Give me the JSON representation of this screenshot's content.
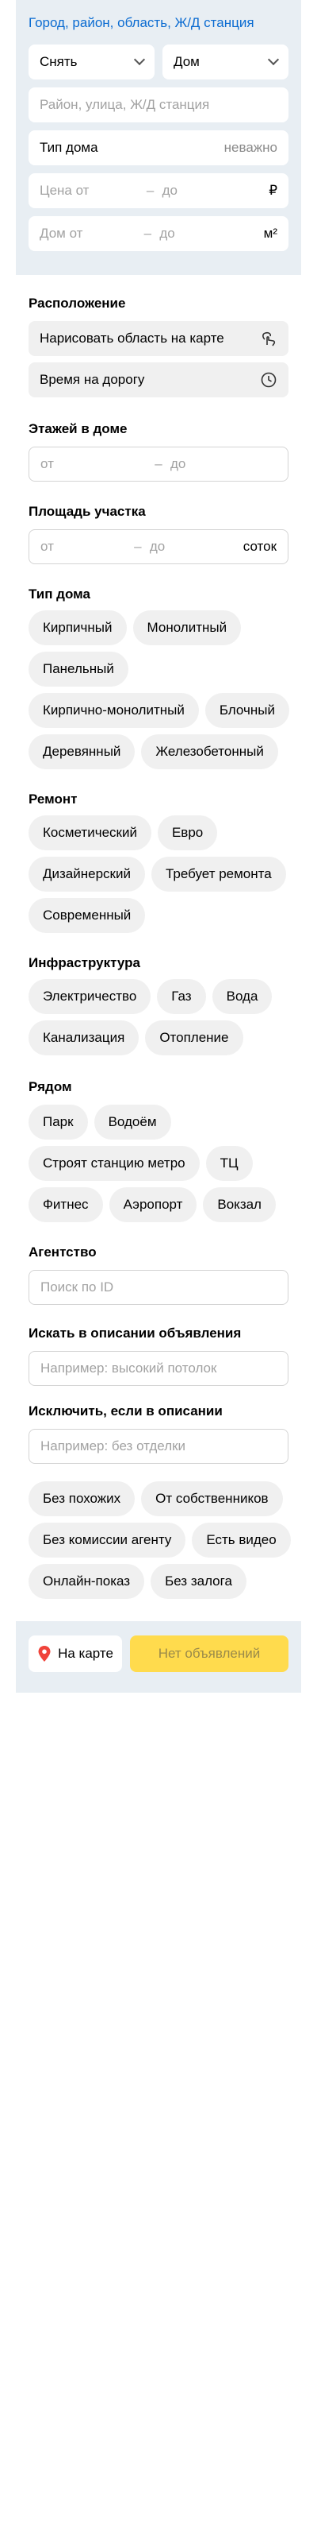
{
  "search_link": "Город, район, область, Ж/Д станция",
  "deal_select": "Снять",
  "type_select": "Дом",
  "address_placeholder": "Район, улица, Ж/Д станция",
  "house_type_label": "Тип дома",
  "house_type_value": "неважно",
  "price": {
    "from": "Цена от",
    "dash": "–",
    "to": "до",
    "unit": "₽"
  },
  "house_area": {
    "from": "Дом от",
    "dash": "–",
    "to": "до",
    "unit": "м²"
  },
  "location": {
    "heading": "Расположение",
    "draw_label": "Нарисовать область на карте",
    "time_label": "Время на дорогу"
  },
  "floors": {
    "heading": "Этажей в доме",
    "from": "от",
    "dash": "–",
    "to": "до"
  },
  "plot": {
    "heading": "Площадь участка",
    "from": "от",
    "dash": "–",
    "to": "до",
    "unit": "соток"
  },
  "building_type": {
    "heading": "Тип дома",
    "chips": [
      "Кирпичный",
      "Монолитный",
      "Панельный",
      "Кирпично-монолитный",
      "Блочный",
      "Деревянный",
      "Железобетонный"
    ]
  },
  "renovation": {
    "heading": "Ремонт",
    "chips": [
      "Косметический",
      "Евро",
      "Дизайнерский",
      "Требует ремонта",
      "Современный"
    ]
  },
  "infrastructure": {
    "heading": "Инфраструктура",
    "chips": [
      "Электричество",
      "Газ",
      "Вода",
      "Канализация",
      "Отопление"
    ]
  },
  "nearby": {
    "heading": "Рядом",
    "chips": [
      "Парк",
      "Водоём",
      "Строят станцию метро",
      "ТЦ",
      "Фитнес",
      "Аэропорт",
      "Вокзал"
    ]
  },
  "agency": {
    "heading": "Агентство",
    "placeholder": "Поиск по ID"
  },
  "search_desc": {
    "heading": "Искать в описании объявления",
    "placeholder": "Например: высокий потолок"
  },
  "exclude_desc": {
    "heading": "Исключить, если в описании",
    "placeholder": "Например: без отделки"
  },
  "extra": {
    "chips": [
      "Без похожих",
      "От собственников",
      "Без комиссии агенту",
      "Есть видео",
      "Онлайн-показ",
      "Без залога"
    ]
  },
  "footer": {
    "map_label": "На карте",
    "submit_label": "Нет объявлений"
  },
  "colors": {
    "accent": "#0a6bd1",
    "submit": "#ffdb4d",
    "panel": "#e8eef3",
    "pin": "#f0433a"
  }
}
